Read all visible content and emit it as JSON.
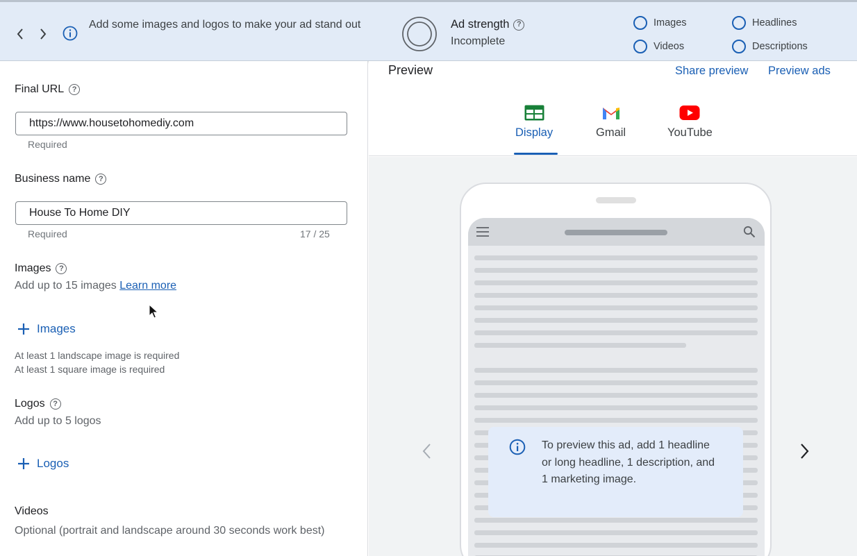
{
  "topbar": {
    "back_icon": "chevron-left-icon",
    "forward_icon": "chevron-right-icon",
    "info_icon": "info-icon",
    "message": "Add some images and logos to make your ad stand out",
    "ad_strength": {
      "title": "Ad strength",
      "status": "Incomplete"
    },
    "checklist": [
      {
        "label": "Images"
      },
      {
        "label": "Headlines"
      },
      {
        "label": "Videos"
      },
      {
        "label": "Descriptions"
      }
    ]
  },
  "form": {
    "final_url": {
      "label": "Final URL",
      "value": "https://www.housetohomediy.com",
      "hint": "Required"
    },
    "business_name": {
      "label": "Business name",
      "value": "House To Home DIY",
      "hint": "Required",
      "counter": "17 / 25"
    },
    "images": {
      "label": "Images",
      "description": "Add up to 15 images",
      "learn_more": "Learn more",
      "add_label": "Images",
      "requirements": [
        "At least 1 landscape image is required",
        "At least 1 square image is required"
      ]
    },
    "logos": {
      "label": "Logos",
      "description": "Add up to 5 logos",
      "add_label": "Logos"
    },
    "videos": {
      "label": "Videos",
      "description": "Optional (portrait and landscape around 30 seconds work best)"
    }
  },
  "preview": {
    "title": "Preview",
    "share_label": "Share preview",
    "preview_ads_label": "Preview ads",
    "tabs": [
      {
        "label": "Display",
        "icon": "display-icon",
        "active": true
      },
      {
        "label": "Gmail",
        "icon": "gmail-icon",
        "active": false
      },
      {
        "label": "YouTube",
        "icon": "youtube-icon",
        "active": false
      }
    ],
    "notice": "To preview this ad, add 1 headline or long headline, 1 description, and 1 marketing image."
  },
  "colors": {
    "accent": "#1a5fb4",
    "topbar_bg": "#e2ebf7",
    "preview_bg": "#f1f3f4",
    "notice_bg": "#e3ecfa",
    "gmail_red": "#ea4335",
    "youtube_red": "#ff0000",
    "display_green": "#188038"
  }
}
